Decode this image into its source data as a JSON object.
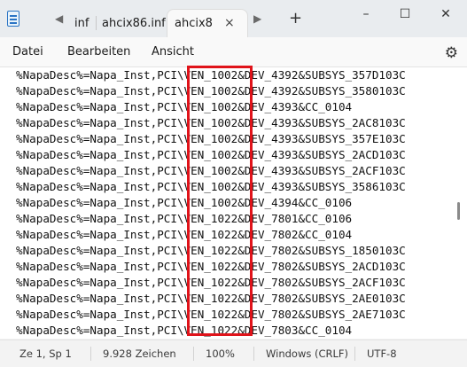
{
  "tabs": [
    {
      "label": "inf"
    },
    {
      "label": "ahcix86.inf"
    },
    {
      "label": "ahcix8"
    }
  ],
  "tab_close": "×",
  "new_tab": "+",
  "nav": {
    "back": "◀",
    "forward": "▶"
  },
  "window": {
    "minimize": "–",
    "maximize": "☐",
    "close": "✕"
  },
  "menu": {
    "file": "Datei",
    "edit": "Bearbeiten",
    "view": "Ansicht"
  },
  "settings_icon": "⚙",
  "lines": [
    "%NapaDesc%=Napa_Inst,PCI\\VEN_1002&DEV_4392&SUBSYS_357D103C",
    "%NapaDesc%=Napa_Inst,PCI\\VEN_1002&DEV_4392&SUBSYS_3580103C",
    "%NapaDesc%=Napa_Inst,PCI\\VEN_1002&DEV_4393&CC_0104",
    "%NapaDesc%=Napa_Inst,PCI\\VEN_1002&DEV_4393&SUBSYS_2AC8103C",
    "%NapaDesc%=Napa_Inst,PCI\\VEN_1002&DEV_4393&SUBSYS_357E103C",
    "%NapaDesc%=Napa_Inst,PCI\\VEN_1002&DEV_4393&SUBSYS_2ACD103C",
    "%NapaDesc%=Napa_Inst,PCI\\VEN_1002&DEV_4393&SUBSYS_2ACF103C",
    "%NapaDesc%=Napa_Inst,PCI\\VEN_1002&DEV_4393&SUBSYS_3586103C",
    "%NapaDesc%=Napa_Inst,PCI\\VEN_1002&DEV_4394&CC_0106",
    "%NapaDesc%=Napa_Inst,PCI\\VEN_1022&DEV_7801&CC_0106",
    "%NapaDesc%=Napa_Inst,PCI\\VEN_1022&DEV_7802&CC_0104",
    "%NapaDesc%=Napa_Inst,PCI\\VEN_1022&DEV_7802&SUBSYS_1850103C",
    "%NapaDesc%=Napa_Inst,PCI\\VEN_1022&DEV_7802&SUBSYS_2ACD103C",
    "%NapaDesc%=Napa_Inst,PCI\\VEN_1022&DEV_7802&SUBSYS_2ACF103C",
    "%NapaDesc%=Napa_Inst,PCI\\VEN_1022&DEV_7802&SUBSYS_2AE0103C",
    "%NapaDesc%=Napa_Inst,PCI\\VEN_1022&DEV_7802&SUBSYS_2AE7103C",
    "%NapaDesc%=Napa_Inst,PCI\\VEN_1022&DEV_7803&CC_0104"
  ],
  "status": {
    "position": "Ze 1, Sp 1",
    "chars": "9.928 Zeichen",
    "zoom": "100%",
    "line_ending": "Windows (CRLF)",
    "encoding": "UTF-8"
  },
  "colors": {
    "highlight": "#e0131a",
    "accent": "#2a74c4"
  }
}
